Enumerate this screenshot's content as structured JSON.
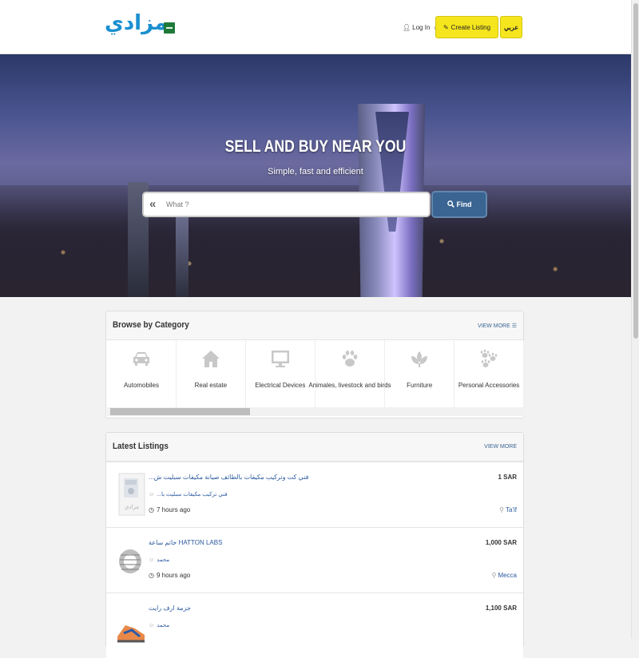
{
  "header": {
    "logo_text": "مزادي",
    "login_label": "Log In",
    "create_listing_label": "Create Listing",
    "language_label": "عربي"
  },
  "hero": {
    "title": "SELL AND BUY NEAR YOU",
    "subtitle": "Simple, fast and efficient",
    "search_placeholder": "What ?",
    "find_label": "Find"
  },
  "categories": {
    "title": "Browse by Category",
    "view_more": "VIEW MORE ☰",
    "items": [
      {
        "label": "Automobiles",
        "icon": "car-icon"
      },
      {
        "label": "Real estate",
        "icon": "home-icon"
      },
      {
        "label": "Electrical Devices",
        "icon": "monitor-icon"
      },
      {
        "label": "Animales, livestock and birds",
        "icon": "paw-icon"
      },
      {
        "label": "Furniture",
        "icon": "leaf-icon"
      },
      {
        "label": "Personal Accessories",
        "icon": "paws-icon"
      }
    ]
  },
  "listings": {
    "title": "Latest Listings",
    "view_more": "VIEW MORE",
    "items": [
      {
        "title": "...فني كت وتركيب مكيفات بالطائف صيانة مكيفات سبليت ش",
        "seller": "...فني تركيب مكيفات سبليت با",
        "time": "7 hours ago",
        "price": "1 SAR",
        "location": "Ta'if"
      },
      {
        "title": "خاتم ساعة HATTON LABS",
        "seller": "محمد",
        "time": "9 hours ago",
        "price": "1,000 SAR",
        "location": "Mecca"
      },
      {
        "title": "جزمة ارف رايت",
        "seller": "محمد",
        "time": "",
        "price": "1,100 SAR",
        "location": ""
      }
    ]
  }
}
